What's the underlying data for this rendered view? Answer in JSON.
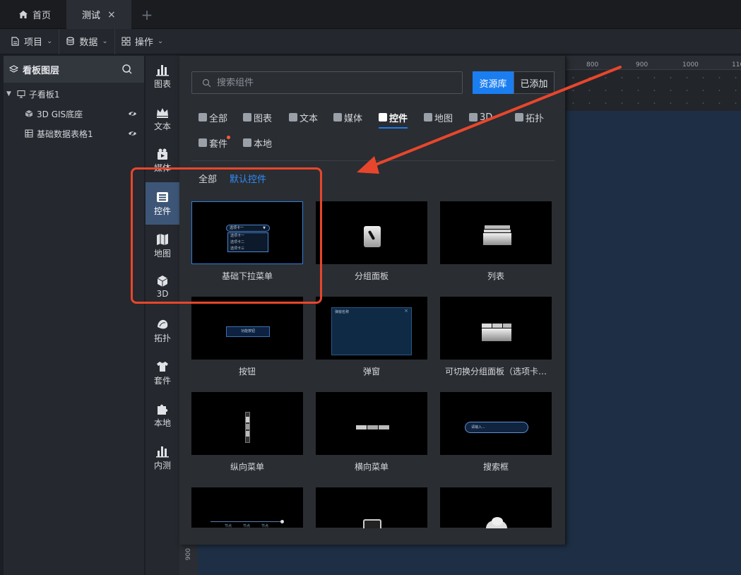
{
  "tabs": {
    "home_label": "首页",
    "active_label": "测试",
    "close_glyph": "×",
    "add_glyph": "+"
  },
  "toolbar": {
    "project_label": "项目",
    "data_label": "数据",
    "ops_label": "操作"
  },
  "layers": {
    "title": "看板图层",
    "items": [
      {
        "label": "子看板1",
        "icon": "monitor-icon"
      },
      {
        "label": "3D GIS底座",
        "icon": "cube-icon"
      },
      {
        "label": "基础数据表格1",
        "icon": "table-icon"
      }
    ]
  },
  "rail": {
    "items": [
      {
        "label": "图表",
        "icon": "bar-chart-icon"
      },
      {
        "label": "文本",
        "icon": "crown-icon"
      },
      {
        "label": "媒体",
        "icon": "media-icon"
      },
      {
        "label": "控件",
        "icon": "widget-icon",
        "active": true
      },
      {
        "label": "地图",
        "icon": "map-icon"
      },
      {
        "label": "3D",
        "icon": "cube-icon"
      },
      {
        "label": "拓扑",
        "icon": "topology-icon"
      },
      {
        "label": "套件",
        "icon": "shirt-icon"
      },
      {
        "label": "本地",
        "icon": "puzzle-icon"
      },
      {
        "label": "内测",
        "icon": "bar-chart-icon"
      }
    ]
  },
  "ruler": {
    "labels": [
      "800",
      "900",
      "1000",
      "110"
    ],
    "left_label": "900"
  },
  "popup": {
    "search_placeholder": "搜索组件",
    "btn_library": "资源库",
    "btn_added": "已添加",
    "categories": [
      "全部",
      "图表",
      "文本",
      "媒体",
      "控件",
      "地图",
      "3D",
      "拓扑",
      "套件",
      "本地"
    ],
    "active_category": "控件",
    "sub_all": "全部",
    "sub_default": "默认控件",
    "cards": [
      {
        "label": "基础下拉菜单",
        "selected": true,
        "thumb_text": "选项卡一",
        "thumb_options": [
          "选项卡一",
          "选项卡二",
          "选项卡三"
        ]
      },
      {
        "label": "分组面板"
      },
      {
        "label": "列表"
      },
      {
        "label": "按钮",
        "thumb_text": "功能按钮"
      },
      {
        "label": "弹窗",
        "thumb_text": "弹窗名称"
      },
      {
        "label": "可切换分组面板（选项卡…"
      },
      {
        "label": "纵向菜单"
      },
      {
        "label": "横向菜单"
      },
      {
        "label": "搜索框",
        "thumb_text": "请输入..."
      },
      {
        "label": "",
        "thumb_text_parts": [
          "节点",
          "节点",
          "节点"
        ]
      },
      {
        "label": ""
      },
      {
        "label": ""
      }
    ]
  },
  "colors": {
    "accent": "#1a7ef1",
    "annotation": "#e8462c",
    "canvas": "#1e2f45"
  }
}
